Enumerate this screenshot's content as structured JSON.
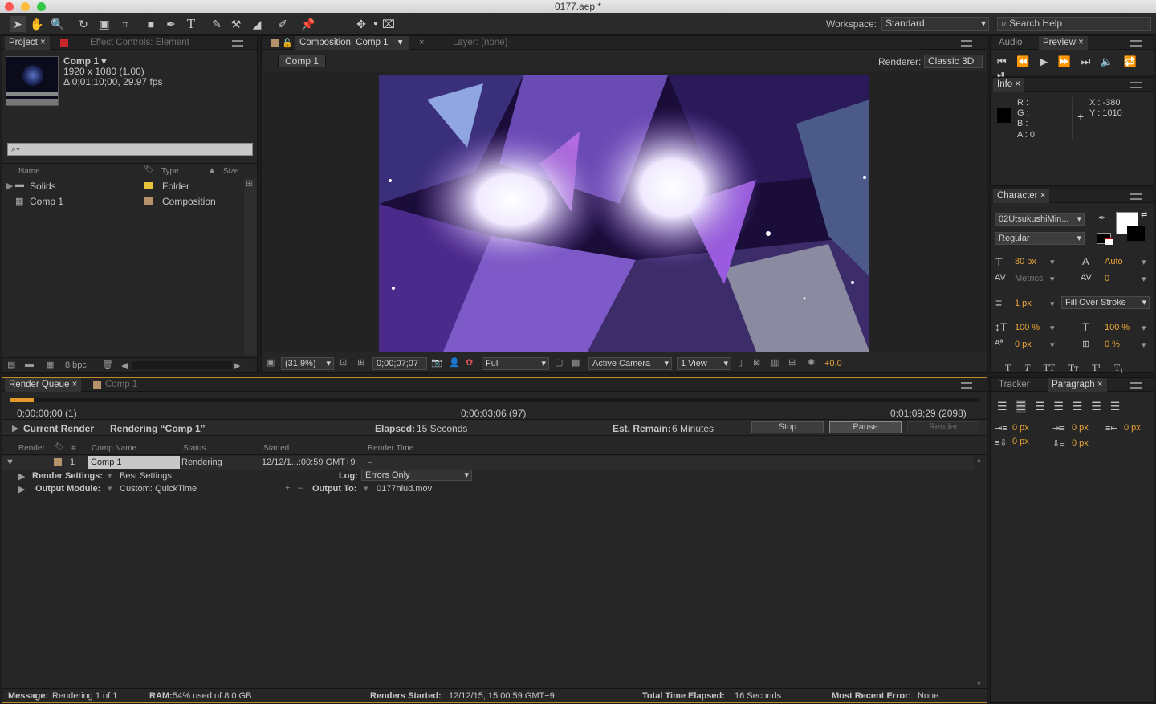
{
  "window": {
    "title": "0177.aep *"
  },
  "toolbar": {
    "workspace_label": "Workspace:",
    "workspace_value": "Standard",
    "search_placeholder": "Search Help"
  },
  "project": {
    "tab": "Project",
    "effect_controls_tab": "Effect Controls: Element",
    "comp_name": "Comp 1 ▾",
    "comp_size": "1920 x 1080 (1.00)",
    "comp_duration": "Δ 0;01;10;00, 29.97 fps",
    "columns": {
      "name": "Name",
      "type": "Type",
      "size": "Size"
    },
    "items": [
      {
        "name": "Solids",
        "type": "Folder",
        "label_color": "#e6c33a"
      },
      {
        "name": "Comp 1",
        "type": "Composition",
        "label_color": "#b5926b"
      }
    ],
    "bpc": "8 bpc"
  },
  "composition": {
    "tab": "Composition: Comp 1",
    "layer_tab": "Layer: (none)",
    "comp_button": "Comp 1",
    "renderer_label": "Renderer:",
    "renderer_value": "Classic 3D",
    "zoom": "(31.9%)",
    "timecode": "0;00;07;07",
    "resolution": "Full",
    "camera": "Active Camera",
    "views": "1 View",
    "exposure": "+0.0"
  },
  "right": {
    "audio_tab": "Audio",
    "preview_tab": "Preview",
    "info_tab": "Info",
    "info": {
      "r": "R :",
      "g": "G :",
      "b": "B :",
      "a": "A : 0",
      "x": "X : -380",
      "y": "Y : 1010"
    },
    "character_tab": "Character",
    "font": "02UtsukushiMin...",
    "style": "Regular",
    "size": "80 px",
    "leading": "Auto",
    "kerning": "Metrics",
    "tracking": "0",
    "stroke": "1 px",
    "stroke_mode": "Fill Over Stroke",
    "vscale": "100 %",
    "hscale": "100 %",
    "baseline": "0 px",
    "tsume": "0 %",
    "tracker_tab": "Tracker",
    "paragraph_tab": "Paragraph",
    "para": {
      "indent_left": "0 px",
      "indent_first": "0 px",
      "indent_right": "0 px",
      "space_before": "0 px",
      "space_after": "0 px"
    }
  },
  "render_queue": {
    "tab": "Render Queue",
    "comp_tab": "Comp 1",
    "progress_fraction": 0.025,
    "time_start": "0;00;00;00 (1)",
    "time_mid": "0;00;03;06 (97)",
    "time_end": "0;01;09;29 (2098)",
    "current_render": "Current Render",
    "rendering": "Rendering “Comp 1”",
    "elapsed_label": "Elapsed:",
    "elapsed": "15 Seconds",
    "remain_label": "Est. Remain:",
    "remain": "6 Minutes",
    "stop": "Stop",
    "pause": "Pause",
    "render": "Render",
    "columns": {
      "render": "Render",
      "num": "#",
      "comp": "Comp Name",
      "status": "Status",
      "started": "Started",
      "render_time": "Render Time"
    },
    "item": {
      "num": "1",
      "comp": "Comp 1",
      "status": "Rendering",
      "started": "12/12/1...:00:59 GMT+9",
      "render_time": "–"
    },
    "render_settings_label": "Render Settings:",
    "render_settings": "Best Settings",
    "log_label": "Log:",
    "log": "Errors Only",
    "output_module_label": "Output Module:",
    "output_module": "Custom: QuickTime",
    "output_to_label": "Output To:",
    "output_to": "0177hiud.mov"
  },
  "status_bar": {
    "message_label": "Message:",
    "message": "Rendering 1 of 1",
    "ram_label": "RAM:",
    "ram": "54% used of 8.0 GB",
    "started_label": "Renders Started:",
    "started": "12/12/15, 15:00:59 GMT+9",
    "total_label": "Total Time Elapsed:",
    "total": "16 Seconds",
    "error_label": "Most Recent Error:",
    "error": "None"
  }
}
